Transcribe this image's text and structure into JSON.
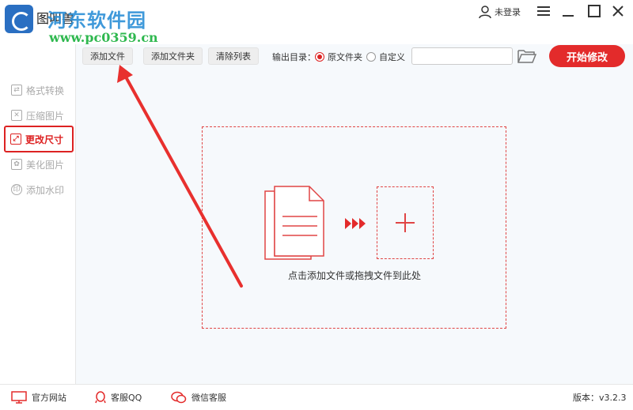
{
  "app": {
    "name": "图叫兽",
    "watermark_text": "河东软件园",
    "watermark_url": "www.pc0359.cn",
    "user_label": "未登录"
  },
  "sidebar": {
    "items": [
      {
        "label": "格式转换",
        "icon": "convert-icon"
      },
      {
        "label": "压缩图片",
        "icon": "compress-icon"
      },
      {
        "label": "更改尺寸",
        "icon": "resize-icon",
        "active": true
      },
      {
        "label": "美化图片",
        "icon": "beautify-icon"
      },
      {
        "label": "添加水印",
        "icon": "watermark-icon"
      }
    ]
  },
  "toolbar": {
    "add_file": "添加文件",
    "add_folder": "添加文件夹",
    "clear_list": "清除列表",
    "output_label": "输出目录：",
    "radio_source": "原文件夹",
    "radio_custom": "自定义",
    "path_value": "",
    "start_label": "开始修改"
  },
  "dropzone": {
    "hint": "点击添加文件或拖拽文件到此处"
  },
  "footer": {
    "website": "官方网站",
    "qq": "客服QQ",
    "wechat": "微信客服",
    "version": "版本：v3.2.3"
  },
  "colors": {
    "accent": "#e32b2b",
    "annotation": "#e8302e",
    "watermark_blue": "#2b8fd6",
    "watermark_green": "#2fb84f"
  }
}
